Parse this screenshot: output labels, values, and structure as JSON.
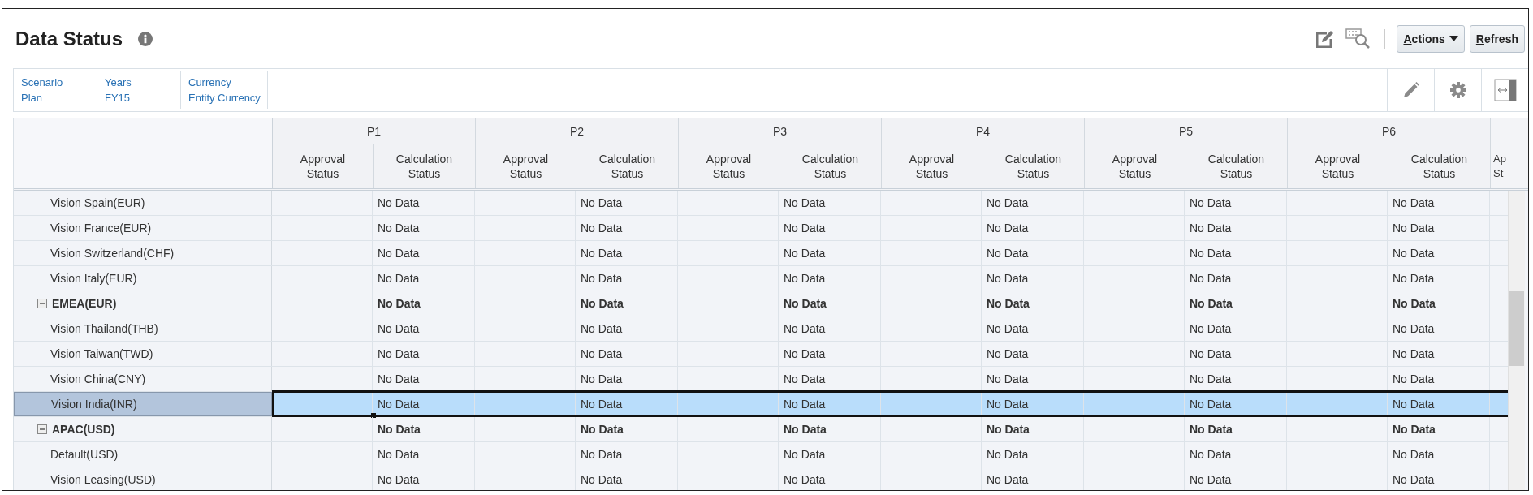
{
  "page": {
    "title": "Data Status"
  },
  "toolbar": {
    "buttons": [
      {
        "label": "Actions",
        "kind": "menu"
      },
      {
        "label": "Refresh",
        "kind": "plain"
      }
    ]
  },
  "pov": [
    {
      "dimension": "Scenario",
      "member": "Plan"
    },
    {
      "dimension": "Years",
      "member": "FY15"
    },
    {
      "dimension": "Currency",
      "member": "Entity Currency"
    }
  ],
  "grid": {
    "periods": [
      {
        "label": "P1",
        "columns": [
          "Approval Status",
          "Calculation Status"
        ]
      },
      {
        "label": "P2",
        "columns": [
          "Approval Status",
          "Calculation Status"
        ]
      },
      {
        "label": "P3",
        "columns": [
          "Approval Status",
          "Calculation Status"
        ]
      },
      {
        "label": "P4",
        "columns": [
          "Approval Status",
          "Calculation Status"
        ]
      },
      {
        "label": "P5",
        "columns": [
          "Approval Status",
          "Calculation Status"
        ]
      },
      {
        "label": "P6",
        "columns": [
          "Approval Status",
          "Calculation Status"
        ]
      }
    ],
    "partial_column": "Ap St",
    "rows": [
      {
        "label": "Vision Spain(EUR)",
        "kind": "member",
        "selected": false,
        "cells": [
          "No Data",
          "No Data",
          "No Data",
          "No Data",
          "No Data",
          "No Data"
        ]
      },
      {
        "label": "Vision France(EUR)",
        "kind": "member",
        "selected": false,
        "cells": [
          "No Data",
          "No Data",
          "No Data",
          "No Data",
          "No Data",
          "No Data"
        ]
      },
      {
        "label": "Vision Switzerland(CHF)",
        "kind": "member",
        "selected": false,
        "cells": [
          "No Data",
          "No Data",
          "No Data",
          "No Data",
          "No Data",
          "No Data"
        ]
      },
      {
        "label": "Vision Italy(EUR)",
        "kind": "member",
        "selected": false,
        "cells": [
          "No Data",
          "No Data",
          "No Data",
          "No Data",
          "No Data",
          "No Data"
        ]
      },
      {
        "label": "EMEA(EUR)",
        "kind": "group",
        "expanded": true,
        "selected": false,
        "cells": [
          "No Data",
          "No Data",
          "No Data",
          "No Data",
          "No Data",
          "No Data"
        ]
      },
      {
        "label": "Vision Thailand(THB)",
        "kind": "member",
        "selected": false,
        "cells": [
          "No Data",
          "No Data",
          "No Data",
          "No Data",
          "No Data",
          "No Data"
        ]
      },
      {
        "label": "Vision Taiwan(TWD)",
        "kind": "member",
        "selected": false,
        "cells": [
          "No Data",
          "No Data",
          "No Data",
          "No Data",
          "No Data",
          "No Data"
        ]
      },
      {
        "label": "Vision China(CNY)",
        "kind": "member",
        "selected": false,
        "cells": [
          "No Data",
          "No Data",
          "No Data",
          "No Data",
          "No Data",
          "No Data"
        ]
      },
      {
        "label": "Vision India(INR)",
        "kind": "member",
        "selected": true,
        "cells": [
          "No Data",
          "No Data",
          "No Data",
          "No Data",
          "No Data",
          "No Data"
        ]
      },
      {
        "label": "APAC(USD)",
        "kind": "group",
        "expanded": true,
        "selected": false,
        "cells": [
          "No Data",
          "No Data",
          "No Data",
          "No Data",
          "No Data",
          "No Data"
        ]
      },
      {
        "label": "Default(USD)",
        "kind": "member",
        "selected": false,
        "cells": [
          "No Data",
          "No Data",
          "No Data",
          "No Data",
          "No Data",
          "No Data"
        ]
      },
      {
        "label": "Vision Leasing(USD)",
        "kind": "member",
        "selected": false,
        "cells": [
          "No Data",
          "No Data",
          "No Data",
          "No Data",
          "No Data",
          "No Data"
        ]
      }
    ]
  }
}
